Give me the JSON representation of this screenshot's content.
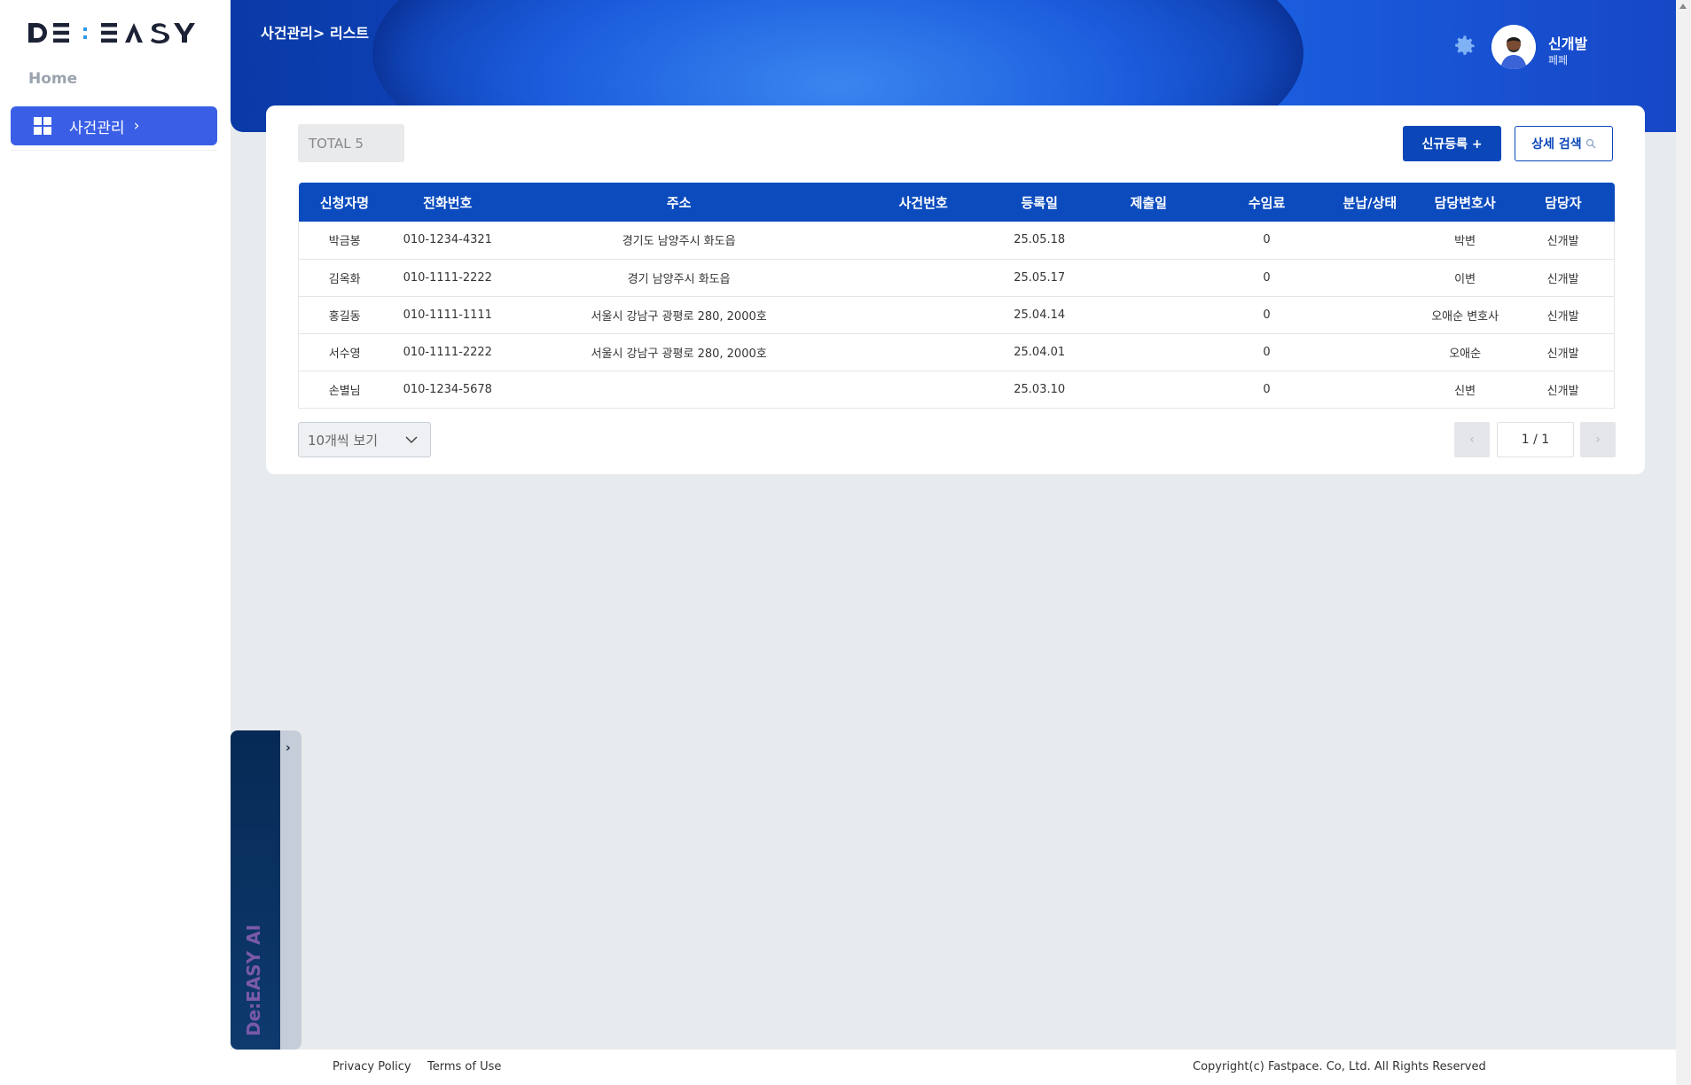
{
  "sidebar": {
    "logo_text": "DE:EASY",
    "home_label": "Home",
    "nav_item_label": "사건관리",
    "nav_item_chevron": "›"
  },
  "header": {
    "breadcrumb": "사건관리> 리스트",
    "user_name": "신개발",
    "user_sub": "페페"
  },
  "toolbar": {
    "total_label": "TOTAL 5",
    "new_button": "신규등록 +",
    "search_button": "상세 검색",
    "search_icon": "🔍"
  },
  "table": {
    "headers": [
      "신청자명",
      "전화번호",
      "주소",
      "사건번호",
      "등록일",
      "제출일",
      "수임료",
      "분납/상태",
      "담당변호사",
      "담당자"
    ],
    "rows": [
      [
        "박금봉",
        "010-1234-4321",
        "경기도 남양주시 화도읍",
        "",
        "25.05.18",
        "",
        "0",
        "",
        "박변",
        "신개발"
      ],
      [
        "김옥화",
        "010-1111-2222",
        "경기 남양주시 화도읍",
        "",
        "25.05.17",
        "",
        "0",
        "",
        "이변",
        "신개발"
      ],
      [
        "홍길동",
        "010-1111-1111",
        "서울시 강남구 광평로 280, 2000호",
        "",
        "25.04.14",
        "",
        "0",
        "",
        "오애순 변호사",
        "신개발"
      ],
      [
        "서수영",
        "010-1111-2222",
        "서울시 강남구 광평로 280, 2000호",
        "",
        "25.04.01",
        "",
        "0",
        "",
        "오애순",
        "신개발"
      ],
      [
        "손별님",
        "010-1234-5678",
        "",
        "",
        "25.03.10",
        "",
        "0",
        "",
        "신변",
        "신개발"
      ]
    ]
  },
  "pagination": {
    "page_size_label": "10개씩 보기",
    "prev": "‹",
    "current": "1 / 1",
    "next": "›"
  },
  "ai_panel": {
    "label": "De:EASY AI",
    "toggle": "›"
  },
  "footer": {
    "privacy": "Privacy Policy",
    "terms": "Terms of Use",
    "copyright": "Copyright(c) Fastpace. Co, Ltd. All Rights Reserved"
  },
  "colors": {
    "primary": "#0b47b8",
    "nav_active": "#3a5fe6",
    "background": "#e8ebee"
  }
}
